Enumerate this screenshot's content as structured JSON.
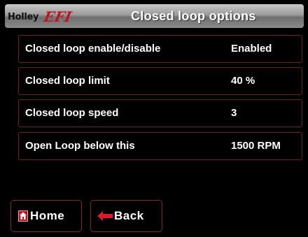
{
  "header": {
    "logo": {
      "brand": "Holley",
      "product": "EFI"
    },
    "title": "Closed loop options"
  },
  "settings": [
    {
      "label": "Closed loop enable/disable",
      "value": "Enabled"
    },
    {
      "label": "Closed loop limit",
      "value": "40 %"
    },
    {
      "label": "Closed loop speed",
      "value": "3"
    },
    {
      "label": "Open Loop below this",
      "value": "1500 RPM"
    }
  ],
  "nav": {
    "home_label": "Home",
    "back_label": "Back"
  },
  "colors": {
    "background": "#000000",
    "row_border": "#6a1f2a",
    "accent_red": "#c1121f",
    "header_gray": "#9a9a9a"
  },
  "icons": {
    "home": "home-icon",
    "back": "arrow-left-icon"
  }
}
